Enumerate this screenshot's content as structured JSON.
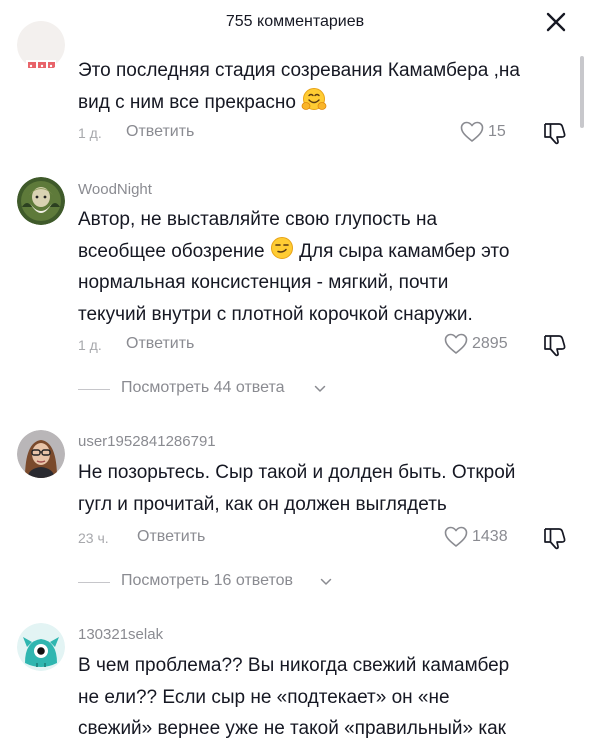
{
  "header": {
    "title": "755 комментариев"
  },
  "comments": [
    {
      "username": "",
      "lines": [
        "Это последняя стадия созревания Камамбера ,на",
        "вид с ним все прекрасно"
      ],
      "time": "1 д.",
      "reply_label": "Ответить",
      "likes": "15"
    },
    {
      "username": "WoodNight",
      "lines": [
        "Автор, не выставляйте свою глупость на",
        "всеобщее обозрение",
        "Для сыра камамбер это",
        "нормальная консистенция - мягкий, почти",
        "текучий внутри с плотной корочкой снаружи."
      ],
      "time": "1 д.",
      "reply_label": "Ответить",
      "likes": "2895",
      "view_replies": "Посмотреть 44 ответа"
    },
    {
      "username": "user1952841286791",
      "lines": [
        "Не позорьтесь. Сыр такой и долден быть. Открой",
        "гугл и прочитай, как он должен выглядеть"
      ],
      "time": "23 ч.",
      "reply_label": "Ответить",
      "likes": "1438",
      "view_replies": "Посмотреть 16 ответов"
    },
    {
      "username": "130321selak",
      "lines": [
        "В чем проблема?? Вы никогда свежий камамбер",
        "не ели?? Если сыр не «подтекает» он «не",
        "свежий» вернее уже не такой «правильный» как"
      ]
    }
  ],
  "icons": {
    "close": "close-icon",
    "like": "heart-outline-icon",
    "dislike": "thumb-down-icon",
    "hug_emoji": "hugging-face-emoji",
    "smirk_emoji": "smirking-face-emoji"
  }
}
